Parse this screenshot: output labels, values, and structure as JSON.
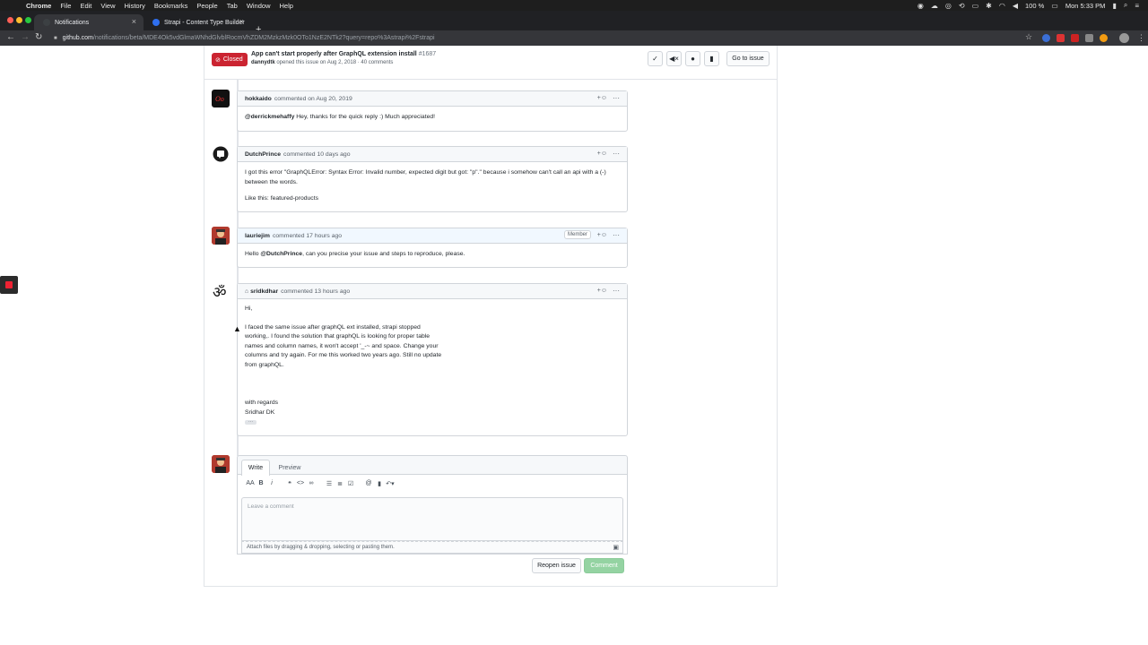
{
  "menubar": {
    "app": "Chrome",
    "items": [
      "File",
      "Edit",
      "View",
      "History",
      "Bookmarks",
      "People",
      "Tab",
      "Window",
      "Help"
    ],
    "battery": "100 %",
    "clock": "Mon 5:33 PM"
  },
  "tabs": [
    {
      "title": "Notifications",
      "favicon_color": "#3c4043"
    },
    {
      "title": "Strapi - Content Type Builder",
      "favicon_color": "#2f6fee"
    }
  ],
  "address": {
    "host": "github.com",
    "path": "/notifications/beta/MDE4Ok5vdGlmaWNhdGlvblRocmVhZDM2MzkzMzk0OTo1NzE2NTk2?query=repo%3Astrapi%2Fstrapi"
  },
  "issue": {
    "status": "Closed",
    "title": "App can't start properly after GraphQL extension install",
    "number": "#1687",
    "author": "dannydtk",
    "meta": "opened this issue on Aug 2, 2018 · 40 comments",
    "goto_label": "Go to issue"
  },
  "comments": [
    {
      "author": "hokkaido",
      "when": "commented on Aug 20, 2019",
      "mention": "@derrickmehaffy",
      "text": "Hey, thanks for the quick reply :) Much appreciated!"
    },
    {
      "author": "DutchPrince",
      "when": "commented 10 days ago",
      "p1": "I got this error \"GraphQLError: Syntax Error: Invalid number, expected digit but got: \"p\".\" because i somehow can't call an api with a (-) between the words.",
      "p2": "Like this: featured-products"
    },
    {
      "author": "lauriejim",
      "when": "commented 17 hours ago",
      "badge": "Member",
      "pre": "Hello",
      "mention": "@DutchPrince",
      "post": ", can you precise your issue and steps to reproduce, please."
    },
    {
      "author": "sridkdhar",
      "when": "commented 13 hours ago",
      "greeting": "Hi,",
      "lines": [
        "I faced the same issue after graphQL ext installed, strapi stopped",
        "working,. I found the solution that graphQL is looking for proper table",
        "names and column names, it won't accept '_-~ and space. Change  your",
        "columns and try again. For me this worked two years ago. Still no update",
        "from graphQL."
      ],
      "sign1": "with regards",
      "sign2": "Sridhar DK",
      "more": "···"
    }
  ],
  "editor": {
    "write_tab": "Write",
    "preview_tab": "Preview",
    "placeholder": "Leave a comment",
    "attach_text": "Attach files by dragging & dropping, selecting or pasting them.",
    "reopen_label": "Reopen issue",
    "comment_label": "Comment"
  },
  "colors": {
    "closed": "#cb2431",
    "comment_btn": "#94d3a2",
    "header_blue": "#f1f8ff"
  }
}
